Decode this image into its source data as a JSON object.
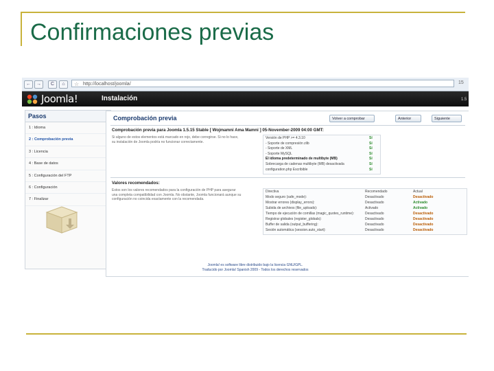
{
  "slide": {
    "title": "Confirmaciones previas"
  },
  "browser": {
    "url": "http://localhost/joomla/",
    "back": "←",
    "forward": "→",
    "reload": "C",
    "home": "⌂",
    "right_label": "15"
  },
  "header": {
    "logo_text": "Joomla!",
    "title": "Instalación",
    "version": "1.5"
  },
  "sidebar": {
    "heading": "Pasos",
    "items": [
      {
        "label": "1 : Idioma"
      },
      {
        "label": "2 : Comprobación previa"
      },
      {
        "label": "3 : Licencia"
      },
      {
        "label": "4 : Base de datos"
      },
      {
        "label": "5 : Configuración del FTP"
      },
      {
        "label": "6 : Configuración"
      },
      {
        "label": "7 : Finalizar"
      }
    ]
  },
  "main": {
    "title": "Comprobación previa",
    "buttons": {
      "recheck": "Volver a comprobar",
      "previous": "Anterior",
      "next": "Siguiente"
    },
    "section1": {
      "title": "Comprobación previa para Joomla 1.5.15 Stable [ Wojmamni Ama Mamni ] 05-November-2009 04:00 GMT:",
      "description": "Si alguno de estos elementos está marcado en rojo, debe corregirse. Si no lo hace, su instalación de Joomla podría no funcionar correctamente.",
      "rows": [
        {
          "label": "Versión de PHP >= 4.3.10",
          "status": "Sí"
        },
        {
          "label": "- Soporte de compresión zlib",
          "status": "Sí"
        },
        {
          "label": "- Soporte de XML",
          "status": "Sí"
        },
        {
          "label": "- Soporte MySQL",
          "status": "Sí"
        },
        {
          "label": "El idioma predeterminado de multibyte (MB)",
          "status": "Sí"
        },
        {
          "label": "Sobrecarga de cadenas multibyte (MB) desactivada",
          "status": "Sí"
        },
        {
          "label": "configuration.php Escribible",
          "status": "Sí"
        }
      ]
    },
    "section2": {
      "title": "Valores recomendados:",
      "description": "Estos son los valores recomendados para la configuración de PHP para asegurar una completa compatibilidad con Joomla. No obstante, Joomla funcionará aunque su configuración no coincida exactamente con la recomendada.",
      "headers": {
        "directive": "Directiva",
        "recommended": "Recomendado",
        "actual": "Actual"
      },
      "rows": [
        {
          "directive": "Modo seguro (safe_mode):",
          "recommended": "Desactivado",
          "actual": "Desactivado",
          "actual_state": "off"
        },
        {
          "directive": "Mostrar errores (display_errors):",
          "recommended": "Desactivado",
          "actual": "Activado",
          "actual_state": "on"
        },
        {
          "directive": "Subida de archivos (file_uploads):",
          "recommended": "Activado",
          "actual": "Activado",
          "actual_state": "on"
        },
        {
          "directive": "Tiempo de ejecución de comillas (magic_quotes_runtime):",
          "recommended": "Desactivado",
          "actual": "Desactivado",
          "actual_state": "off"
        },
        {
          "directive": "Registrar globales (register_globals):",
          "recommended": "Desactivado",
          "actual": "Desactivado",
          "actual_state": "off"
        },
        {
          "directive": "Buffer de salida (output_buffering):",
          "recommended": "Desactivado",
          "actual": "Desactivado",
          "actual_state": "off"
        },
        {
          "directive": "Sesión automática (session.auto_start):",
          "recommended": "Desactivado",
          "actual": "Desactivado",
          "actual_state": "off"
        }
      ]
    }
  },
  "footer": {
    "line1": "Joomla! es software libre distribuido bajo la licencia GNU/GPL.",
    "line2": "Traducido por Joomla! Spanish 2009 - Todos los derechos reservados"
  },
  "colors": {
    "title_green": "#1a6b48",
    "frame_gold": "#c8b23a",
    "status_ok": "#2a8a2a",
    "status_off": "#b85a00"
  }
}
